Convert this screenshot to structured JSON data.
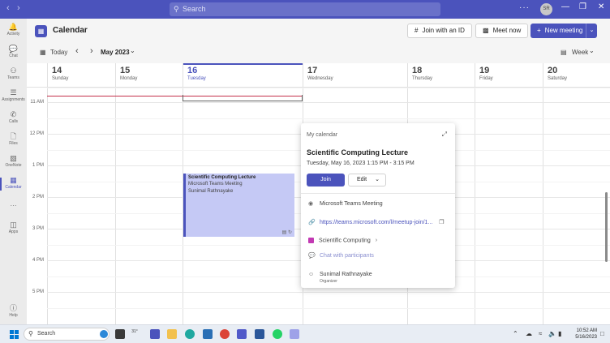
{
  "titlebar": {
    "search_placeholder": "Search",
    "avatar_initials": "SR",
    "more": "···"
  },
  "rail": [
    {
      "label": "Activity",
      "icon": "bell-icon"
    },
    {
      "label": "Chat",
      "icon": "chat-icon"
    },
    {
      "label": "Teams",
      "icon": "teams-icon"
    },
    {
      "label": "Assignments",
      "icon": "assignments-icon"
    },
    {
      "label": "Calls",
      "icon": "phone-icon"
    },
    {
      "label": "Files",
      "icon": "file-icon"
    },
    {
      "label": "OneNote",
      "icon": "onenote-icon"
    },
    {
      "label": "Calendar",
      "icon": "calendar-icon"
    },
    {
      "label": "···",
      "icon": "more-icon"
    },
    {
      "label": "Apps",
      "icon": "apps-icon"
    },
    {
      "label": "Help",
      "icon": "help-icon"
    }
  ],
  "header": {
    "title": "Calendar",
    "join_id_label": "Join with an ID",
    "meet_now_label": "Meet now",
    "new_meeting_label": "New meeting"
  },
  "toolbar": {
    "today_label": "Today",
    "month_label": "May 2023",
    "view_label": "Week"
  },
  "days": [
    {
      "num": "14",
      "name": "Sunday"
    },
    {
      "num": "15",
      "name": "Monday"
    },
    {
      "num": "16",
      "name": "Tuesday"
    },
    {
      "num": "17",
      "name": "Wednesday"
    },
    {
      "num": "18",
      "name": "Thursday"
    },
    {
      "num": "19",
      "name": "Friday"
    },
    {
      "num": "20",
      "name": "Saturday"
    }
  ],
  "times": [
    "11 AM",
    "12 PM",
    "1 PM",
    "2 PM",
    "3 PM",
    "4 PM",
    "5 PM"
  ],
  "event": {
    "title": "Scientific Computing Lecture",
    "subtitle": "Microsoft Teams Meeting",
    "organizer": "Sunimal Rathnayake"
  },
  "popup": {
    "calendar_name": "My calendar",
    "title": "Scientific Computing Lecture",
    "datetime": "Tuesday, May 16, 2023 1:15 PM - 3:15 PM",
    "join_label": "Join",
    "edit_label": "Edit",
    "meeting_type": "Microsoft Teams Meeting",
    "link": "https://teams.microsoft.com/l/meetup-join/1...",
    "channel": "Scientific Computing",
    "chat_label": "Chat with participants",
    "organizer_name": "Sunimal Rathnayake",
    "organizer_role": "Organizer"
  },
  "taskbar": {
    "search_placeholder": "Search",
    "weather": "31°",
    "time": "10:52 AM",
    "date": "5/16/2023"
  },
  "colors": {
    "brand": "#4b53bc",
    "event_fill": "#c5c9f5",
    "now_line": "#c4314b"
  }
}
